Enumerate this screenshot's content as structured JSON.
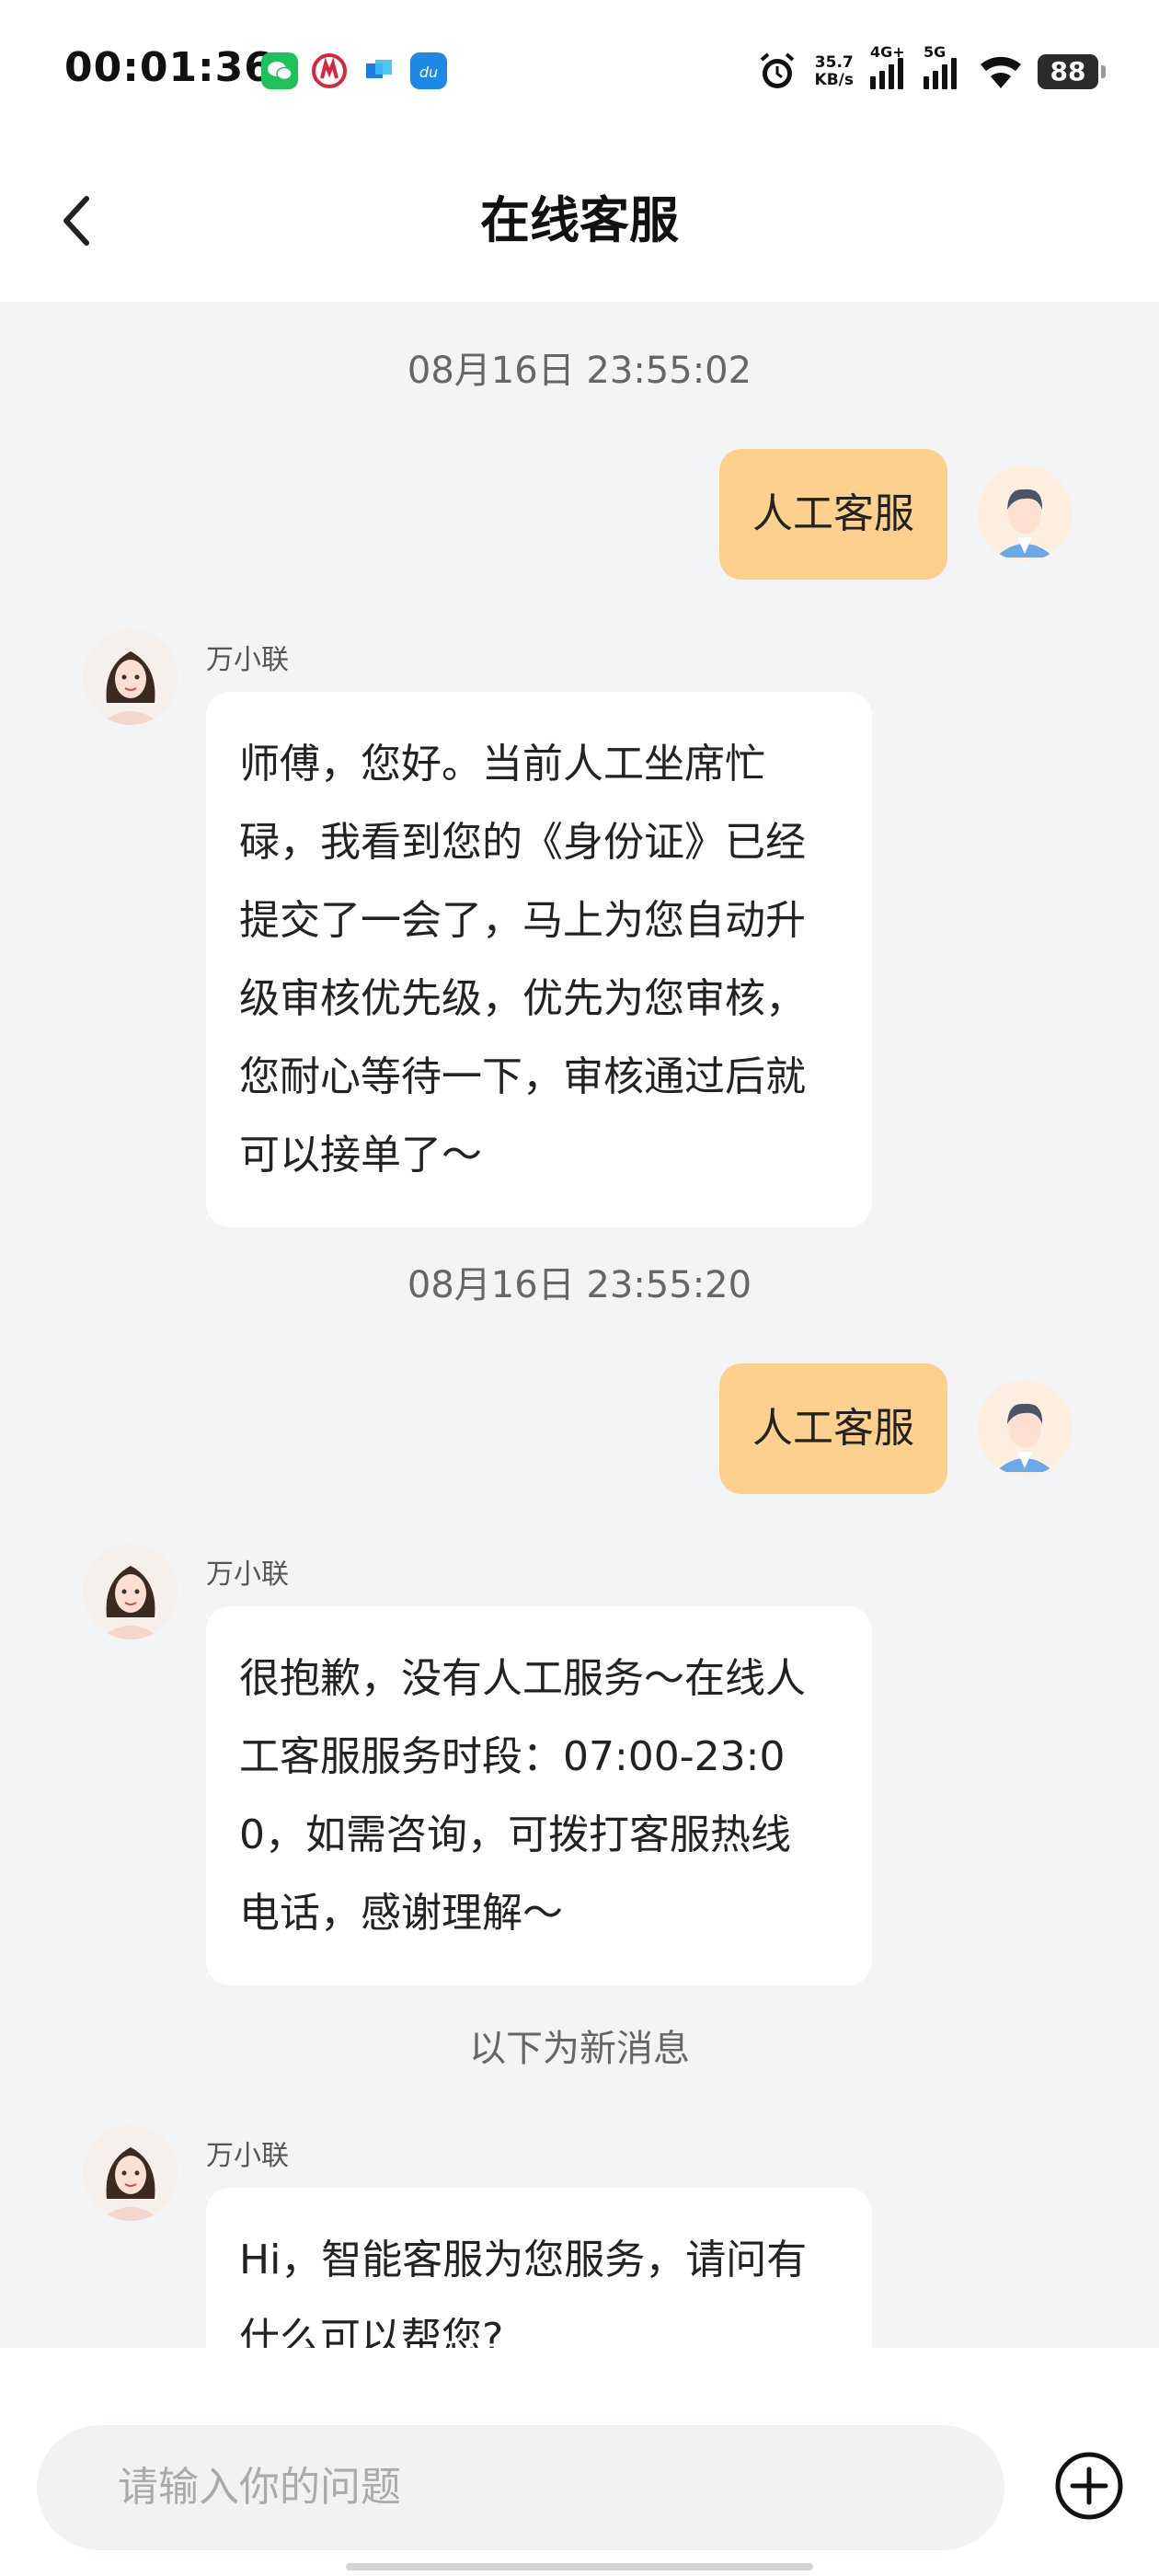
{
  "status_bar": {
    "time": "00:01:36",
    "net_speed_value": "35.7",
    "net_speed_unit": "KB/s",
    "signal1_tag": "4G+",
    "signal2_tag": "5G",
    "battery": "88",
    "icons": [
      "wechat-icon",
      "app-red-icon",
      "app-blue-icon",
      "app-du-icon",
      "alarm-icon",
      "signal-icon",
      "wifi-icon"
    ]
  },
  "header": {
    "title": "在线客服",
    "back_icon": "chevron-left-icon"
  },
  "messages": [
    {
      "type": "timestamp",
      "text": "08月16日 23:55:02"
    },
    {
      "type": "user",
      "text": "人工客服"
    },
    {
      "type": "agent",
      "name": "万小联",
      "lines": [
        "师傅，您好。当前人工坐席忙",
        "碌，我看到您的《身份证》已经",
        "提交了一会了，马上为您自动升",
        "级审核优先级，优先为您审核，",
        "您耐心等待一下，审核通过后就",
        "可以接单了～"
      ]
    },
    {
      "type": "timestamp",
      "text": "08月16日 23:55:20"
    },
    {
      "type": "user",
      "text": "人工客服"
    },
    {
      "type": "agent",
      "name": "万小联",
      "lines": [
        "很抱歉，没有人工服务～在线人",
        "工客服服务时段：07:00-23:0",
        "0，如需咨询，可拨打客服热线",
        "电话，感谢理解～"
      ]
    },
    {
      "type": "divider",
      "text": "以下为新消息"
    },
    {
      "type": "agent",
      "name": "万小联",
      "lines": [
        "Hi，智能客服为您服务，请问有",
        "什么可以帮您?"
      ]
    }
  ],
  "input": {
    "placeholder": "请输入你的问题",
    "plus_icon": "plus-circle-icon"
  },
  "colors": {
    "user_bubble": "#fdd08d",
    "background": "#f3f4f6"
  }
}
